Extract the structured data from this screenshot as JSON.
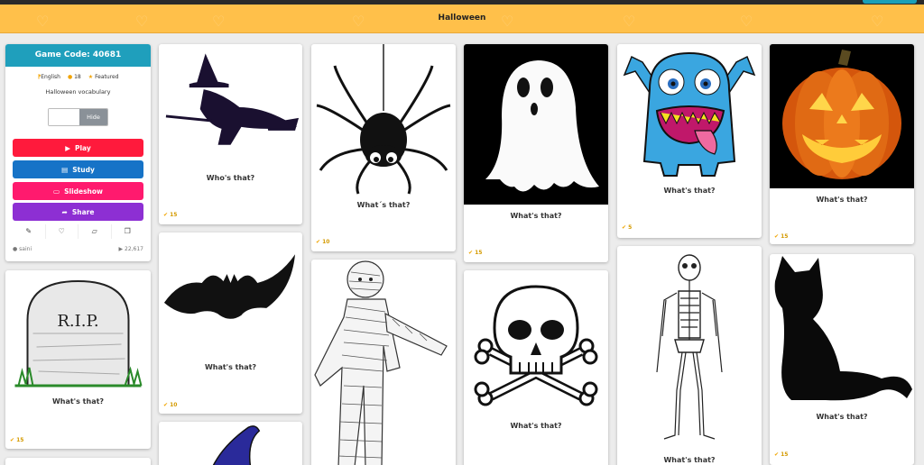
{
  "page": {
    "title": "Halloween"
  },
  "info": {
    "game_code": "Game Code: 40681",
    "language": "English",
    "count": "18",
    "featured": "Featured",
    "description": "Halloween vocabulary",
    "toggle_label": "Hide",
    "buttons": {
      "play": "Play",
      "study": "Study",
      "slideshow": "Slideshow",
      "share": "Share"
    },
    "author": "saini",
    "plays": "22,617"
  },
  "cards": [
    {
      "caption": "Who's that?",
      "stat": "15",
      "icon": "witch-icon"
    },
    {
      "caption": "What's that?",
      "stat": "10",
      "icon": "bat-icon"
    },
    {
      "caption": "What´s that?",
      "stat": "10",
      "icon": "spider-icon"
    },
    {
      "caption": "What's that?",
      "stat": "15",
      "icon": "ghost-icon"
    },
    {
      "caption": "What's that?",
      "stat": "",
      "icon": "skull-crossbones-icon"
    },
    {
      "caption": "What's that?",
      "stat": "5",
      "icon": "monster-icon"
    },
    {
      "caption": "What's that?",
      "stat": "",
      "icon": "skeleton-icon"
    },
    {
      "caption": "What's that?",
      "stat": "15",
      "icon": "pumpkin-icon"
    },
    {
      "caption": "What's that?",
      "stat": "15",
      "icon": "cat-icon"
    },
    {
      "caption": "What's that?",
      "stat": "15",
      "icon": "tombstone-icon"
    },
    {
      "caption": "",
      "stat": "",
      "icon": "mummy-icon"
    },
    {
      "caption": "",
      "stat": "",
      "icon": "witch-hat-icon"
    }
  ],
  "tombstone_text": "R.I.P."
}
